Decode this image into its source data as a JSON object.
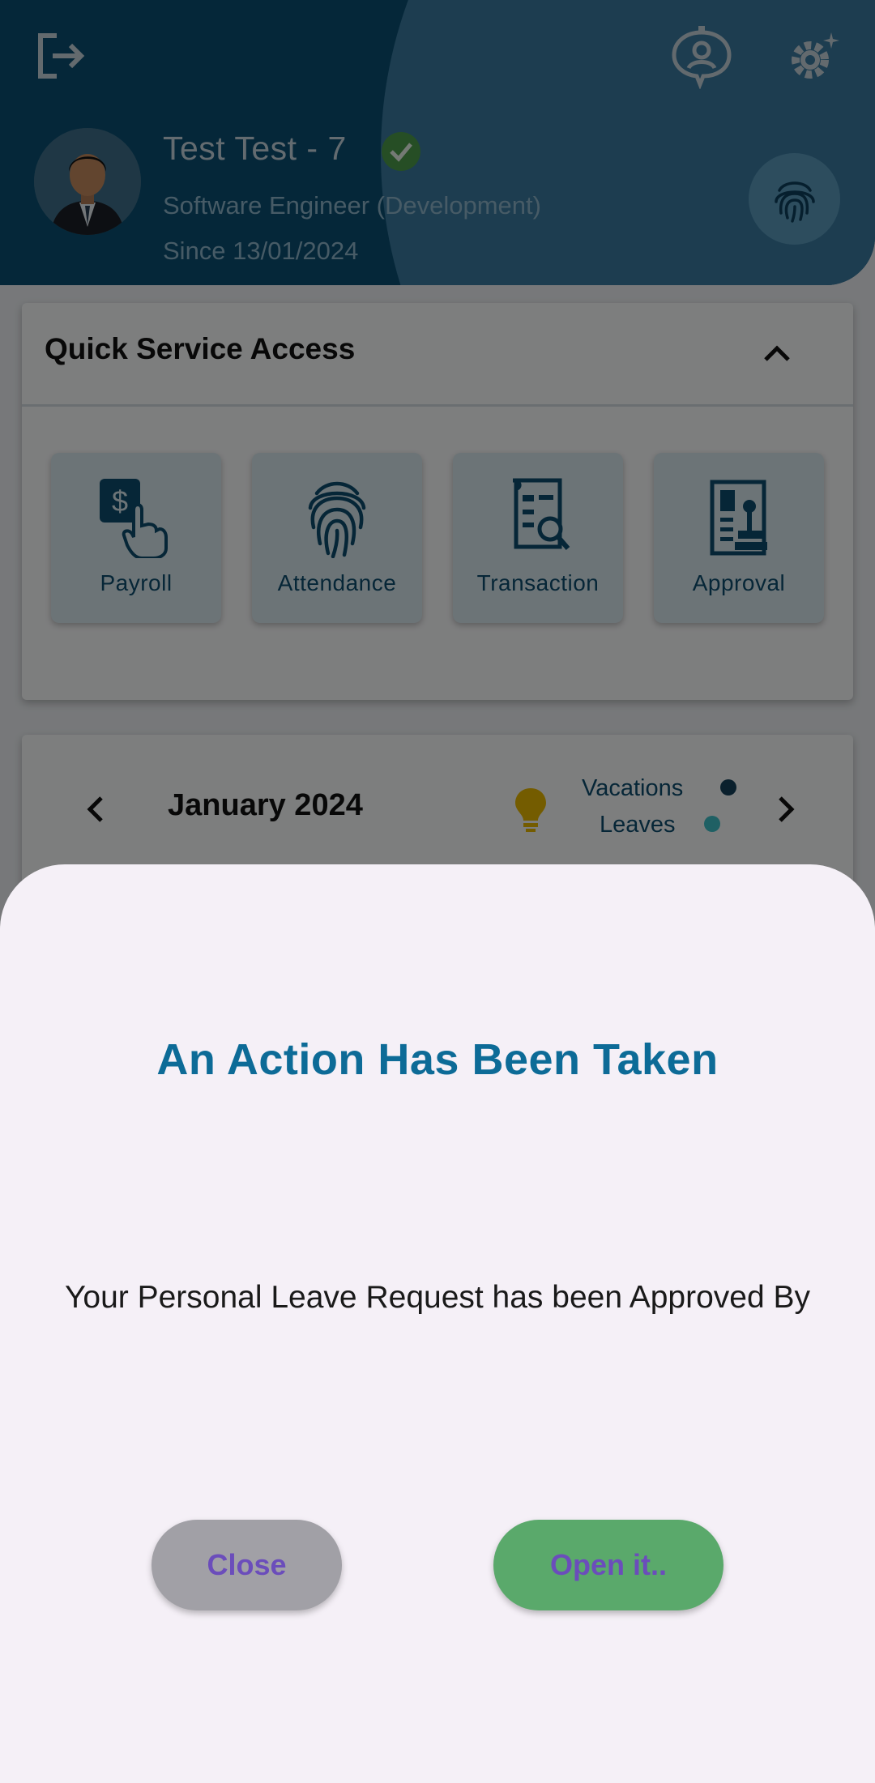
{
  "header": {
    "user_name": "Test Test - 7",
    "role": "Software Engineer (Development)",
    "since": "Since 13/01/2024"
  },
  "quick_service": {
    "title": "Quick Service Access",
    "tiles": [
      {
        "label": "Payroll",
        "icon": "payroll-hand-dollar-icon"
      },
      {
        "label": "Attendance",
        "icon": "fingerprint-icon"
      },
      {
        "label": "Transaction",
        "icon": "document-search-icon"
      },
      {
        "label": "Approval",
        "icon": "approval-stamp-icon"
      }
    ]
  },
  "calendar": {
    "month": "January 2024",
    "legend": [
      {
        "label": "Vacations",
        "color": "#15405a"
      },
      {
        "label": "Leaves",
        "color": "#3fc1c9"
      }
    ]
  },
  "dialog": {
    "title": "An Action Has Been Taken",
    "message": "Your Personal Leave Request has been Approved By",
    "close_label": "Close",
    "open_label": "Open it.."
  },
  "colors": {
    "brand": "#0a4f72",
    "accent_title": "#0d6b97",
    "button_text": "#6b4dbb",
    "open_button": "#5aa96b",
    "close_button": "#a1a0a6"
  }
}
